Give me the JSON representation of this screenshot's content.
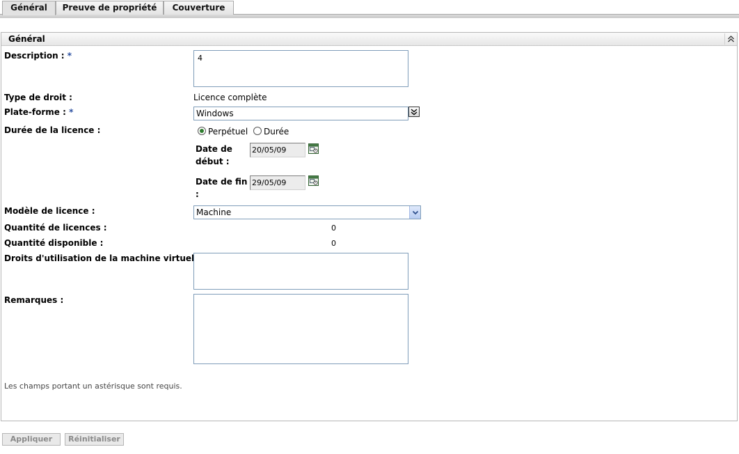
{
  "tabs": [
    {
      "label": "Général",
      "active": true
    },
    {
      "label": "Preuve de propriété",
      "active": false
    },
    {
      "label": "Couverture",
      "active": false
    }
  ],
  "panel": {
    "title": "Général",
    "collapse_icon": "double-chevron-up-icon"
  },
  "form": {
    "description": {
      "label": "Description :",
      "required_mark": "*",
      "value": "4"
    },
    "type_droit": {
      "label": "Type de droit :",
      "value": "Licence complète"
    },
    "plateforme": {
      "label": "Plate-forme :",
      "required_mark": "*",
      "value": "Windows",
      "button_icon": "double-chevron-down-icon"
    },
    "duree_licence": {
      "label": "Durée de la licence :",
      "options": [
        "Perpétuel",
        "Durée"
      ],
      "selected": "Perpétuel",
      "date_debut": {
        "label_line1": "Date de",
        "label_line2": "début :",
        "value": "20/05/09",
        "icon": "calendar-icon"
      },
      "date_fin": {
        "label_line1": "Date de fin",
        "label_line2": ":",
        "value": "29/05/09",
        "icon": "calendar-icon"
      }
    },
    "modele_licence": {
      "label": "Modèle de licence :",
      "value": "Machine"
    },
    "quantite_licences": {
      "label": "Quantité de licences :",
      "value": "0"
    },
    "quantite_disponible": {
      "label": "Quantité disponible :",
      "value": "0"
    },
    "droits_vm": {
      "label": "Droits d'utilisation de la machine virtuelle :",
      "value": ""
    },
    "remarques": {
      "label": "Remarques :",
      "value": ""
    }
  },
  "required_note": "Les champs portant un astérisque sont requis.",
  "buttons": {
    "apply": "Appliquer",
    "reset": "Réinitialiser"
  },
  "colors": {
    "required_mark": "#2a4fa0",
    "field_border": "#7f9db9",
    "radio_selected": "#2f7d2f"
  }
}
